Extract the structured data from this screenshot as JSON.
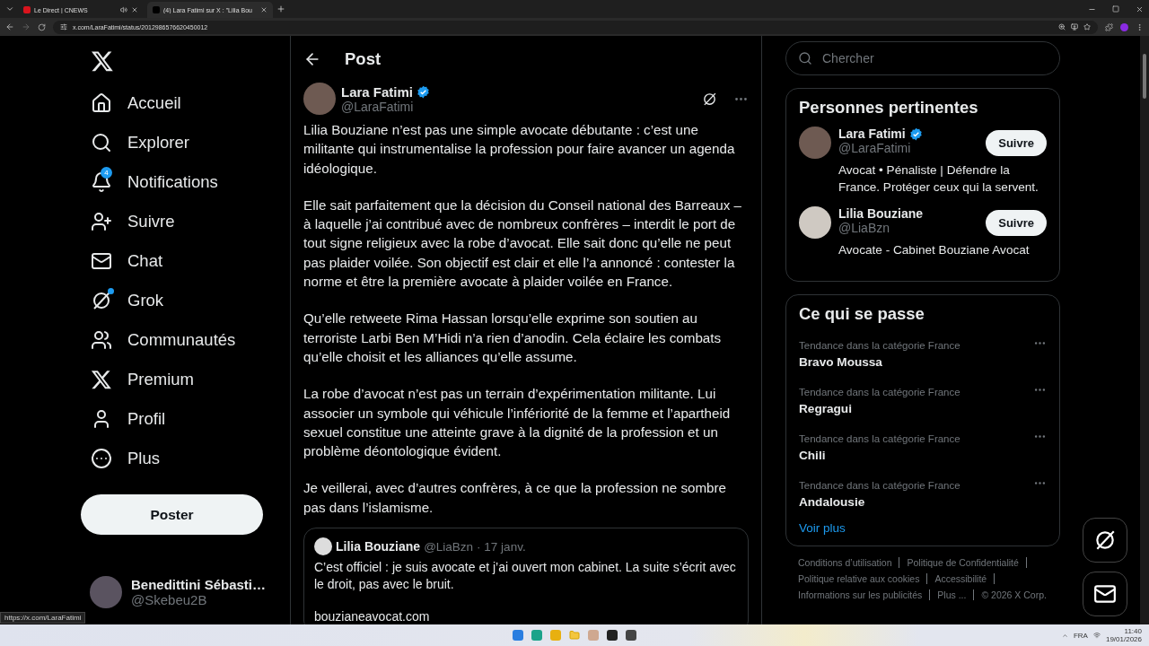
{
  "browser": {
    "tabs": [
      {
        "title": "Le Direct | CNEWS",
        "selected": false,
        "audio": true
      },
      {
        "title": "(4) Lara Fatimi sur X : \"Lilia Bou",
        "selected": true
      }
    ],
    "url": "x.com/LaraFatimi/status/2012986576620450012",
    "status_url": "https://x.com/LaraFatimi"
  },
  "nav": {
    "items": [
      {
        "label": "Accueil"
      },
      {
        "label": "Explorer"
      },
      {
        "label": "Notifications",
        "badge": "4"
      },
      {
        "label": "Suivre"
      },
      {
        "label": "Chat"
      },
      {
        "label": "Grok",
        "unread": true
      },
      {
        "label": "Communautés"
      },
      {
        "label": "Premium"
      },
      {
        "label": "Profil"
      },
      {
        "label": "Plus"
      }
    ],
    "post_button": "Poster",
    "account": {
      "name": "Benedittini Sébasti…",
      "handle": "@Skebeu2B"
    }
  },
  "post": {
    "header": "Post",
    "author": {
      "name": "Lara Fatimi",
      "handle": "@LaraFatimi",
      "verified": true
    },
    "paragraphs": [
      "Lilia Bouziane n’est pas une simple avocate débutante : c’est une militante qui instrumentalise la profession pour faire avancer un agenda idéologique.",
      "Elle sait parfaitement que la décision du Conseil national des Barreaux – à laquelle j’ai contribué avec de nombreux confrères – interdit le port de tout signe religieux avec la robe d’avocat. Elle sait donc qu’elle ne peut pas plaider voilée. Son objectif est clair et elle l’a annoncé : contester la norme et être la première avocate à plaider voilée en France.",
      "Qu’elle retweete Rima Hassan lorsqu’elle exprime son soutien au terroriste Larbi Ben M’Hidi n’a rien d’anodin. Cela éclaire les combats qu’elle choisit et les alliances qu’elle assume.",
      "La robe d’avocat n’est pas un terrain d’expérimentation militante. Lui associer un symbole qui véhicule l’infériorité de la femme et l’apartheid sexuel constitue une atteinte grave à la dignité de la profession et un problème déontologique évident.",
      "Je veillerai, avec d’autres confrères, à ce que la profession ne sombre pas dans l’islamisme."
    ],
    "quote": {
      "name": "Lilia Bouziane",
      "handle": "@LiaBzn",
      "date": "· 17 janv.",
      "text": "C’est officiel : je suis avocate et j’ai ouvert mon cabinet. La suite s’écrit avec le droit, pas avec le bruit.",
      "link": "bouzianeavocat.com"
    }
  },
  "search": {
    "placeholder": "Chercher"
  },
  "people": {
    "title": "Personnes pertinentes",
    "items": [
      {
        "name": "Lara Fatimi",
        "handle": "@LaraFatimi",
        "verified": true,
        "bio": "Avocat • Pénaliste | Défendre la France. Protéger ceux qui la servent.",
        "button": "Suivre"
      },
      {
        "name": "Lilia Bouziane",
        "handle": "@LiaBzn",
        "verified": false,
        "bio": "Avocate - Cabinet Bouziane Avocat",
        "button": "Suivre"
      }
    ]
  },
  "trends": {
    "title": "Ce qui se passe",
    "items": [
      {
        "context": "Tendance dans la catégorie France",
        "name": "Bravo Moussa"
      },
      {
        "context": "Tendance dans la catégorie France",
        "name": "Regragui"
      },
      {
        "context": "Tendance dans la catégorie France",
        "name": "Chili"
      },
      {
        "context": "Tendance dans la catégorie France",
        "name": "Andalousie"
      }
    ],
    "more": "Voir plus"
  },
  "footer": {
    "links": [
      "Conditions d’utilisation",
      "Politique de Confidentialité",
      "Politique relative aux cookies",
      "Accessibilité",
      "Informations sur les publicités",
      "Plus ..."
    ],
    "copyright": "© 2026 X Corp."
  },
  "taskbar": {
    "language": "FRA",
    "time": "11:40",
    "date": "19/01/2026"
  }
}
